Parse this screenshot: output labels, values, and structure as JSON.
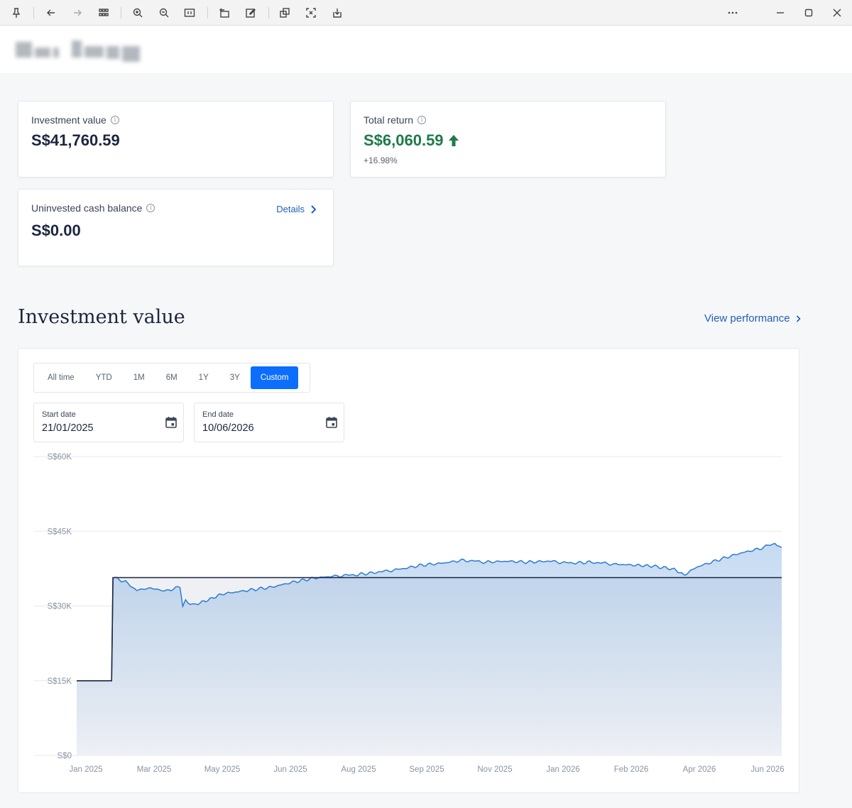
{
  "toolbar": {
    "icons": [
      "pin-icon",
      "back-icon",
      "forward-icon",
      "grid-icon",
      "zoom-in-icon",
      "zoom-out-icon",
      "fit-icon",
      "rotate-icon",
      "edit-icon",
      "copy-icon",
      "capture-icon",
      "download-icon",
      "more-icon",
      "minimize-icon",
      "maximize-icon",
      "close-icon"
    ]
  },
  "cards": {
    "investment_value": {
      "label": "Investment value",
      "value": "S$41,760.59"
    },
    "total_return": {
      "label": "Total return",
      "value": "S$6,060.59",
      "percent": "+16.98%"
    },
    "cash_balance": {
      "label": "Uninvested cash balance",
      "value": "S$0.00",
      "link": "Details"
    }
  },
  "section": {
    "title": "Investment value",
    "view_performance": "View performance"
  },
  "range_buttons": [
    "All time",
    "YTD",
    "1M",
    "6M",
    "1Y",
    "3Y",
    "Custom"
  ],
  "active_range": "Custom",
  "dates": {
    "start_label": "Start date",
    "start_value": "21/01/2025",
    "end_label": "End date",
    "end_value": "10/06/2026"
  },
  "colors": {
    "accent": "#0d6efd",
    "link": "#1f5fb6",
    "positive": "#1f7a4a",
    "value_line": "#2f7bd0",
    "deposit_line": "#1c2640"
  },
  "chart_data": {
    "type": "area",
    "y_ticks": [
      "S$60K",
      "S$45K",
      "S$30K",
      "S$15K",
      "S$0"
    ],
    "x_ticks": [
      "Jan 2025",
      "Mar 2025",
      "May 2025",
      "Jun 2025",
      "Aug 2025",
      "Sep 2025",
      "Nov 2025",
      "Jan 2026",
      "Feb 2026",
      "Apr 2026",
      "Jun 2026"
    ],
    "ylim": [
      0,
      60000
    ],
    "xlim": [
      "2025-01-21",
      "2026-06-10"
    ],
    "series": [
      {
        "kind": "value",
        "x": [
          "2025-01-21",
          "2025-02-15",
          "2025-02-16",
          "2025-02-25",
          "2025-03-05",
          "2025-03-15",
          "2025-03-25",
          "2025-04-05",
          "2025-04-07",
          "2025-04-09",
          "2025-04-15",
          "2025-04-25",
          "2025-05-05",
          "2025-05-20",
          "2025-06-10",
          "2025-06-25",
          "2025-07-10",
          "2025-07-25",
          "2025-08-10",
          "2025-08-25",
          "2025-09-10",
          "2025-09-25",
          "2025-10-10",
          "2025-10-25",
          "2025-11-10",
          "2025-11-25",
          "2025-12-10",
          "2025-12-25",
          "2026-01-10",
          "2026-01-25",
          "2026-02-10",
          "2026-02-25",
          "2026-03-10",
          "2026-03-25",
          "2026-04-01",
          "2026-04-10",
          "2026-04-25",
          "2026-05-10",
          "2026-05-25",
          "2026-06-05",
          "2026-06-10"
        ],
        "y": [
          15000,
          15000,
          35800,
          34800,
          33200,
          33600,
          33000,
          33800,
          29800,
          31000,
          30200,
          31200,
          32400,
          33000,
          33800,
          34800,
          35600,
          36000,
          36300,
          36800,
          37400,
          38200,
          38600,
          39200,
          38800,
          39000,
          38800,
          39000,
          38600,
          38800,
          38400,
          38200,
          38000,
          37400,
          36200,
          37800,
          39200,
          40500,
          41500,
          42600,
          41760
        ]
      },
      {
        "kind": "deposits",
        "x": [
          "2025-01-21",
          "2025-02-15",
          "2025-02-16",
          "2026-06-10"
        ],
        "y": [
          15000,
          15000,
          35700,
          35700
        ]
      }
    ]
  }
}
